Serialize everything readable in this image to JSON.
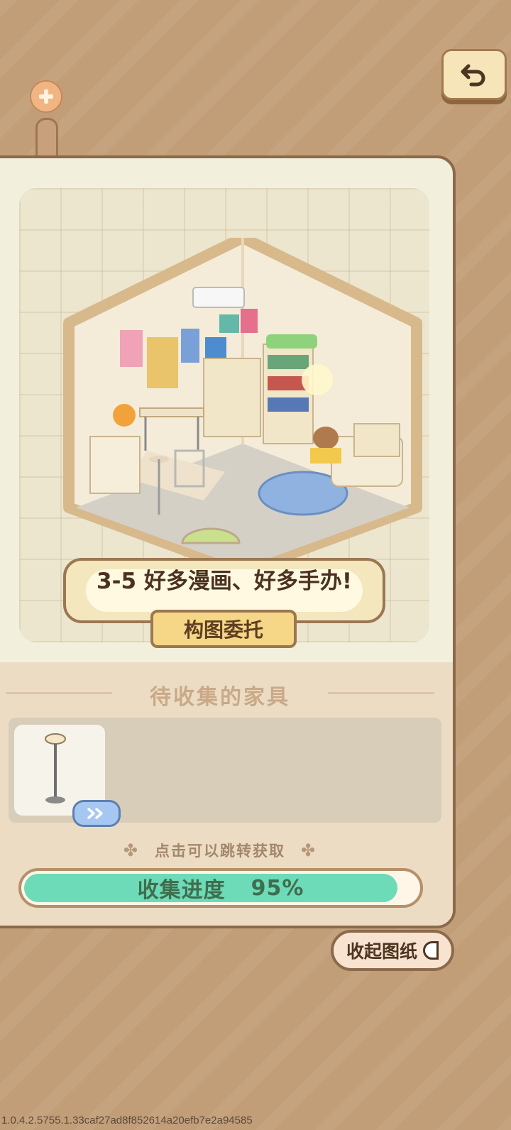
{
  "header": {
    "back_icon": "undo-arrow-icon",
    "plus_icon": "plus-icon"
  },
  "room": {
    "title": "3-5 好多漫画、好多手办!",
    "commission_label": "构图委托"
  },
  "collection": {
    "section_title": "待收集的家具",
    "items": [
      {
        "icon": "floor-lamp-icon",
        "go_icon": "double-chevron-right-icon"
      }
    ],
    "hint": "点击可以跳转获取",
    "progress_label": "收集进度",
    "progress_value": "95%",
    "progress_fraction": 0.95
  },
  "collapse_button": {
    "label": "收起图纸"
  },
  "version": "1.0.4.2.5755.1.33caf27ad8f852614a20efb7e2a94585",
  "colors": {
    "background": "#c29e78",
    "panel": "#f2f0dc",
    "progress_fill": "#6ddab8",
    "border": "#8b6a4c"
  }
}
